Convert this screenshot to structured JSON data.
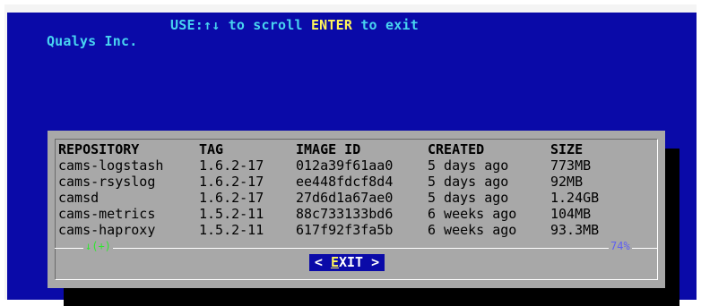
{
  "header": {
    "company": "Qualys Inc.",
    "hint_prefix": "USE:↑↓ to scroll ",
    "hint_key": "ENTER",
    "hint_suffix": " to exit"
  },
  "table": {
    "columns": [
      "REPOSITORY",
      "TAG",
      "IMAGE ID",
      "CREATED",
      "SIZE"
    ],
    "rows": [
      [
        "cams-logstash",
        "1.6.2-17",
        "012a39f61aa0",
        "5 days ago",
        "773MB"
      ],
      [
        "cams-rsyslog",
        "1.6.2-17",
        "ee448fdcf8d4",
        "5 days ago",
        "92MB"
      ],
      [
        "camsd",
        "1.6.2-17",
        "27d6d1a67ae0",
        "5 days ago",
        "1.24GB"
      ],
      [
        "cams-metrics",
        "1.5.2-11",
        "88c733133bd6",
        "6 weeks ago",
        "104MB"
      ],
      [
        "cams-haproxy",
        "1.5.2-11",
        "617f92f3fa5b",
        "6 weeks ago",
        "93.3MB"
      ]
    ]
  },
  "scroll": {
    "indicator": "↓(+)",
    "percent_text": "74%"
  },
  "exit_button": {
    "left": "< ",
    "hotkey": "E",
    "rest": "XIT",
    "right": " >"
  }
}
